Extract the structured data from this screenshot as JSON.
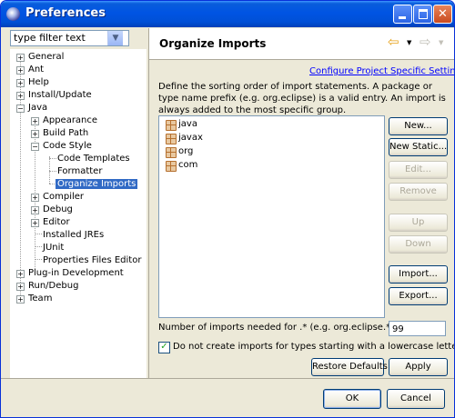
{
  "window": {
    "title": "Preferences"
  },
  "filter": {
    "value": "type filter text"
  },
  "tree": {
    "general": "General",
    "ant": "Ant",
    "help": "Help",
    "install_update": "Install/Update",
    "java": "Java",
    "appearance": "Appearance",
    "build_path": "Build Path",
    "code_style": "Code Style",
    "code_templates": "Code Templates",
    "formatter": "Formatter",
    "organize_imports": "Organize Imports",
    "compiler": "Compiler",
    "debug": "Debug",
    "editor": "Editor",
    "installed_jres": "Installed JREs",
    "junit": "JUnit",
    "properties_files_editor": "Properties Files Editor",
    "plugin_development": "Plug-in Development",
    "run_debug": "Run/Debug",
    "team": "Team"
  },
  "page": {
    "title": "Organize Imports",
    "configure_link": "Configure Project Specific Settings...",
    "description": "Define the sorting order of import statements. A package or type name prefix (e.g. org.eclipse) is a valid entry. An import is always added to the most specific group.",
    "packages": [
      "java",
      "javax",
      "org",
      "com"
    ]
  },
  "buttons": {
    "new": "New...",
    "new_static": "New Static...",
    "edit": "Edit...",
    "remove": "Remove",
    "up": "Up",
    "down": "Down",
    "import": "Import...",
    "export": "Export...",
    "restore_defaults": "Restore Defaults",
    "apply": "Apply",
    "ok": "OK",
    "cancel": "Cancel"
  },
  "imports_threshold": {
    "label": "Number of imports needed for .* (e.g. org.eclipse.*):",
    "value": "99"
  },
  "lowercase_option": {
    "label": "Do not create imports for types starting with a lowercase letter",
    "checked": true
  }
}
